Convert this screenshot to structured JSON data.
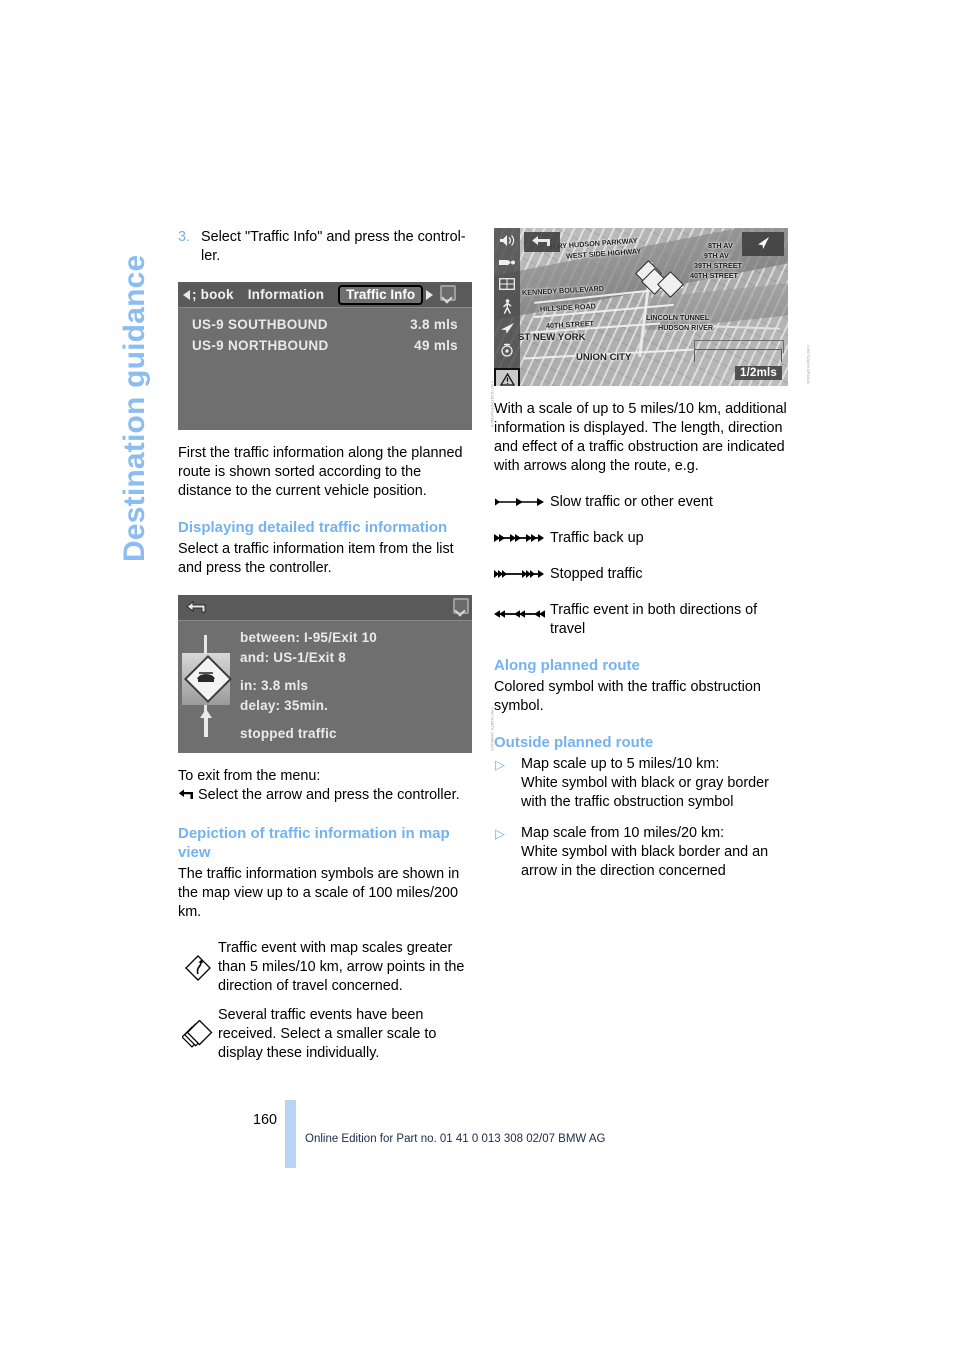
{
  "chapter": {
    "title": "Destination guidance"
  },
  "left": {
    "step": {
      "number": "3.",
      "text": "Select \"Traffic Info\" and press the control-ler."
    },
    "nav_screenshot": {
      "caption": "VI9078JMTKOF0A05BJN",
      "menu_left_label": "; book",
      "menu_middle_label": "Information",
      "menu_selected_label": "Traffic Info",
      "rows": [
        {
          "name": "US-9 SOUTHBOUND",
          "distance": "3.8 mls"
        },
        {
          "name": "US-9 NORTHBOUND",
          "distance": "49 mls"
        }
      ]
    },
    "intro_paragraph": "First the traffic information along the planned route is shown sorted according to the distance to the current vehicle position.",
    "section_displaying": {
      "heading": "Displaying detailed traffic information",
      "body": "Select a traffic information item from the list and press the controller."
    },
    "detail_screenshot": {
      "caption": "VI9078JMTK 2WM6A05",
      "line_between": "between: I-95/Exit 10",
      "line_and": "and: US-1/Exit 8",
      "line_in": "in: 3.8 mls",
      "line_delay": "delay: 35min.",
      "line_status": "stopped traffic"
    },
    "exit_menu": {
      "title": "To exit from the menu:",
      "instruction": "Select the arrow and press the controller."
    },
    "section_depiction": {
      "heading": "Depiction of traffic information in map view",
      "body": "The traffic information symbols are shown in the map view up to a scale of 100 miles/200 km."
    },
    "symbols": [
      {
        "icon": "diamond-arrow-icon",
        "text": "Traffic event with map scales greater than 5 miles/10 km, arrow points in the direction of travel concerned."
      },
      {
        "icon": "stacked-diamond-icon",
        "text": "Several traffic events have been received. Select a smaller scale to display these individually."
      }
    ]
  },
  "right": {
    "map_screenshot": {
      "caption": "VI9078JMTKOF0A06",
      "scale_label": "1/2mls",
      "icons": [
        "speaker-icon",
        "vehicle-icon",
        "split-screen-icon",
        "pedestrian-icon",
        "arrow-icon",
        "compass-icon",
        "warning-triangle-icon"
      ],
      "labels": [
        "H.RY HUDSON PARKWAY",
        "WEST SIDE HIGHWAY",
        "8TH AV",
        "9TH AV",
        "39TH STREET",
        "40TH STREET",
        "KENNEDY BOULEVARD",
        "HILLSIDE ROAD",
        "40TH STREET",
        "ST NEW YORK",
        "UNION CITY",
        "LINCOLN TUNNEL",
        "HUDSON RIVER"
      ]
    },
    "map_paragraph": "With a scale of up to 5 miles/10 km, additional information is displayed. The length, direction and effect of a traffic obstruction are indicated with arrows along the route, e.g.",
    "arrow_legend": [
      {
        "icon": "single-arrow-line-icon",
        "label": "Slow traffic or other event"
      },
      {
        "icon": "double-arrow-line-icon",
        "label": "Traffic back up"
      },
      {
        "icon": "triple-arrow-line-icon",
        "label": "Stopped traffic"
      },
      {
        "icon": "bidirectional-arrow-line-icon",
        "label": "Traffic event in both directions of travel"
      }
    ],
    "section_along": {
      "heading": "Along planned route",
      "body": "Colored symbol with the traffic obstruction symbol."
    },
    "section_outside": {
      "heading": "Outside planned route",
      "items": [
        "Map scale up to 5 miles/10 km:\nWhite symbol with black or gray border with the traffic obstruction symbol",
        "Map scale from 10 miles/20 km:\nWhite symbol with black border and an arrow in the direction concerned"
      ]
    }
  },
  "footer": {
    "page_number": "160",
    "text": "Online Edition for Part no. 01 41 0 013 308 02/07 BMW AG"
  },
  "colors": {
    "accent_blue": "#74b3ef",
    "chapter_blue": "#8cbdf0",
    "footer_bar": "#b9d4f2"
  }
}
